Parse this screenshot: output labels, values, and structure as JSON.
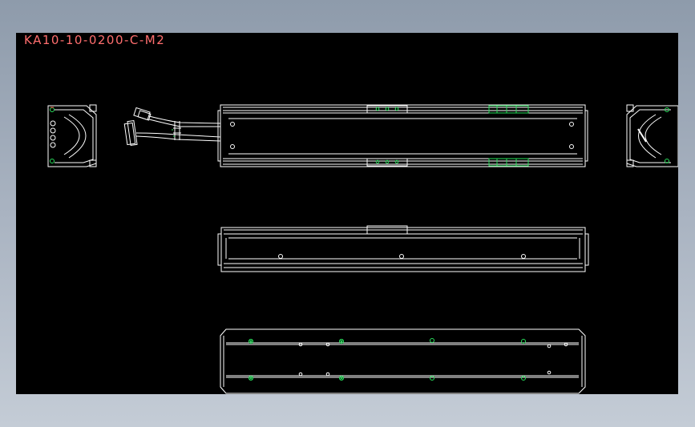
{
  "drawing": {
    "title": "KA10-10-0200-C-M2",
    "colors": {
      "background": "#000000",
      "line": "#ffffff",
      "accent": "#29e05c",
      "title": "#ff6e6e",
      "marker": "#ff3333"
    }
  }
}
